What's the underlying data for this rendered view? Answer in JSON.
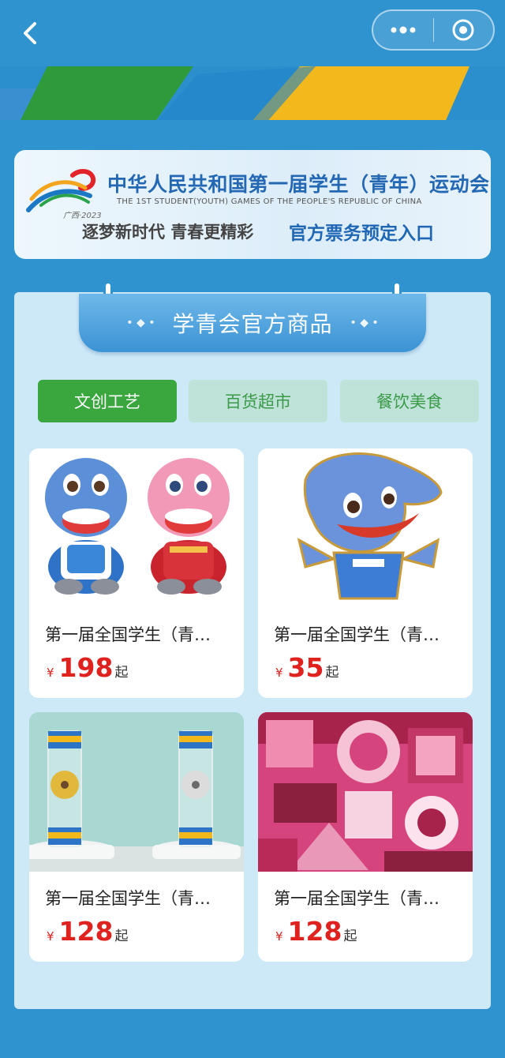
{
  "nav": {
    "back_icon": "chevron-left-icon",
    "more_icon": "more-dots-icon",
    "close_icon": "target-circle-icon"
  },
  "header_card": {
    "title_cn": "中华人民共和国第一届学生（青年）运动会",
    "title_en": "THE 1ST STUDENT(YOUTH) GAMES OF THE PEOPLE'S REPUBLIC OF CHINA",
    "logo_text": "广西·2023",
    "slogan": "逐梦新时代 青春更精彩",
    "entry": "官方票务预定入口"
  },
  "section": {
    "title": "学青会官方商品",
    "dots_left": "• ◆ •",
    "dots_right": "• ◆ •"
  },
  "tabs": [
    {
      "label": "文创工艺",
      "active": true
    },
    {
      "label": "百货超市",
      "active": false
    },
    {
      "label": "餐饮美食",
      "active": false
    }
  ],
  "products": [
    {
      "name": "第一届全国学生（青…",
      "currency": "¥",
      "price": "198",
      "suffix": "起",
      "image": "dolphin-plush-pair"
    },
    {
      "name": "第一届全国学生（青…",
      "currency": "¥",
      "price": "35",
      "suffix": "起",
      "image": "dolphin-pin"
    },
    {
      "name": "第一届全国学生（青…",
      "currency": "¥",
      "price": "128",
      "suffix": "起",
      "image": "windmill-ornament-pair"
    },
    {
      "name": "第一届全国学生（青…",
      "currency": "¥",
      "price": "128",
      "suffix": "起",
      "image": "pink-pattern-scarf"
    }
  ],
  "colors": {
    "background": "#2f93cf",
    "panel": "#cde8f7",
    "tab_active": "#3aa63e",
    "tab_inactive": "#bfe3d8",
    "price": "#e0221e",
    "title_blue": "#2468b4"
  }
}
